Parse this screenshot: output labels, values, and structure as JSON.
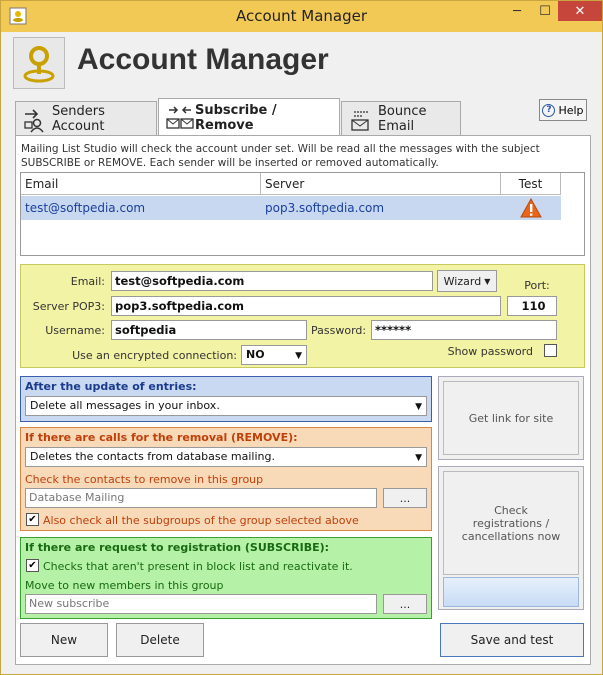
{
  "window": {
    "title": "Account Manager",
    "minimize": "─",
    "maximize": "☐",
    "close": "✕"
  },
  "header": {
    "title": "Account Manager"
  },
  "tabs": [
    {
      "label": "Senders Account"
    },
    {
      "label": "Subscribe / Remove"
    },
    {
      "label": "Bounce Email"
    }
  ],
  "help": {
    "label": "Help"
  },
  "description": "Mailing List Studio will check the account under set. Will be read all the messages with the subject SUBSCRIBE or REMOVE. Each sender will be inserted or removed automatically.",
  "table": {
    "columns": [
      "Email",
      "Server",
      "Test"
    ],
    "rows": [
      {
        "email": "test@softpedia.com",
        "server": "pop3.softpedia.com",
        "test": "warning"
      }
    ]
  },
  "account": {
    "email_label": "Email:",
    "email_value": "test@softpedia.com",
    "wizard_label": "Wizard",
    "port_label": "Port:",
    "port_value": "110",
    "server_label": "Server POP3:",
    "server_value": "pop3.softpedia.com",
    "username_label": "Username:",
    "username_value": "softpedia",
    "password_label": "Password:",
    "password_value": "******",
    "encrypted_label": "Use an encrypted connection:",
    "encrypted_value": "NO",
    "show_password_label": "Show password"
  },
  "update": {
    "title": "After the update of entries:",
    "option": "Delete all messages in your inbox."
  },
  "removal": {
    "title": "If there are calls for the removal (REMOVE):",
    "option": "Deletes the contacts from database mailing.",
    "group_label": "Check the contacts to remove in this group",
    "group_value": "Database Mailing",
    "browse": "...",
    "subgroups_label": "Also check all the subgroups of the group selected above"
  },
  "subscribe": {
    "title": "If there are request to registration (SUBSCRIBE):",
    "blocklist_label": "Checks that aren't present in block list and reactivate it.",
    "move_label": "Move to new members in this group",
    "group_value": "New subscribe",
    "browse": "..."
  },
  "side": {
    "get_link": "Get link for site",
    "check_reg": "Check registrations / cancellations now"
  },
  "footer": {
    "new": "New",
    "delete": "Delete",
    "save_test": "Save and test"
  },
  "colors": {
    "titlebar": "#f3c956",
    "yellow": "#f3f3a6",
    "blue_section": "#c9d9f2",
    "orange_section": "#f8d9b8",
    "green_section": "#b5f2a8"
  }
}
